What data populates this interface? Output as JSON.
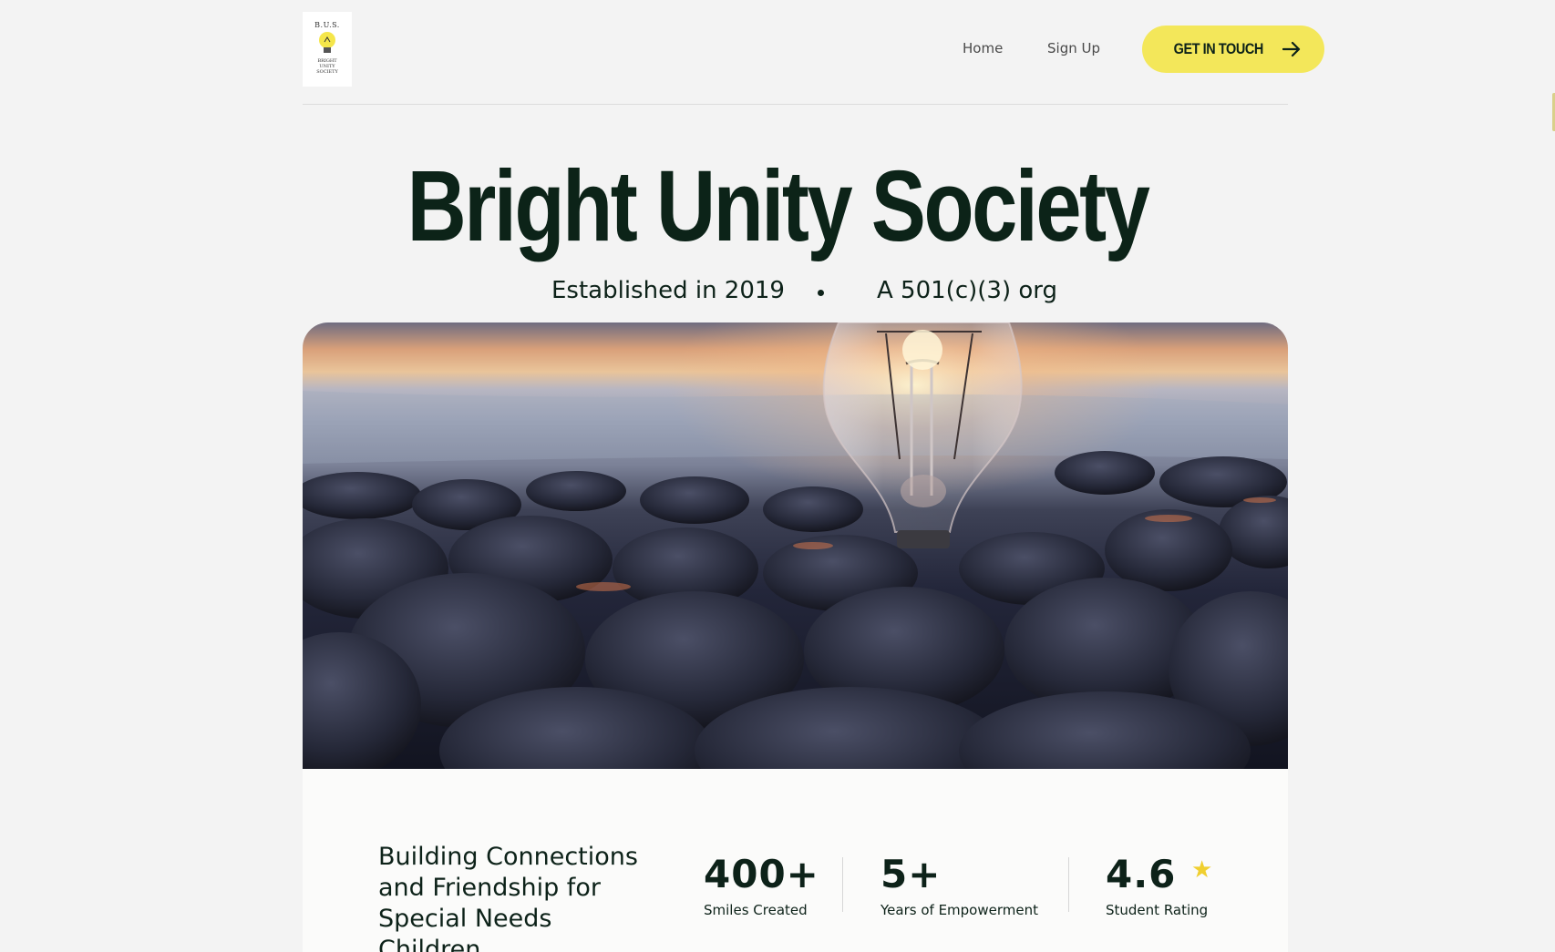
{
  "header": {
    "logo": {
      "line1": "B.U.S.",
      "line2": "BRIGHT\nUNITY\nSOCIETY"
    },
    "nav": [
      {
        "label": "Home"
      },
      {
        "label": "Sign Up"
      }
    ],
    "cta_label": "GET IN TOUCH"
  },
  "hero": {
    "title": "Bright Unity Society",
    "established": "Established in 2019",
    "org": "A 501(c)(3) org"
  },
  "stats": {
    "tagline": "Building Connections and Friendship for Special Needs Children",
    "items": [
      {
        "value": "400+",
        "label": "Smiles Created"
      },
      {
        "value": "5+",
        "label": "Years of Empowerment"
      },
      {
        "value": "4.6",
        "label": "Student Rating"
      }
    ]
  },
  "colors": {
    "accent": "#f3e75a",
    "text": "#0d2219",
    "background": "#f3f3f3",
    "star": "#f0cf2f"
  },
  "icons": {
    "cta": "arrow-right-icon",
    "rating": "star-icon",
    "separator": "dot-separator"
  }
}
